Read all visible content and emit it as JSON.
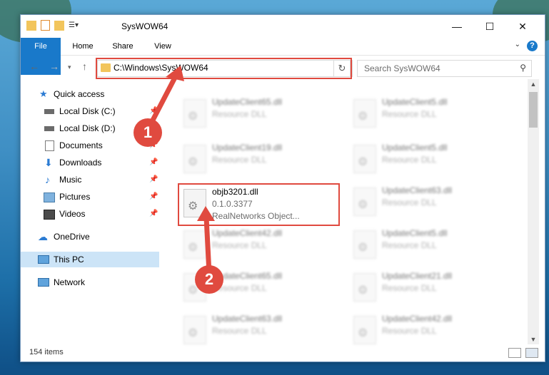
{
  "window": {
    "title": "SysWOW64",
    "controls": {
      "minimize": "—",
      "maximize": "☐",
      "close": "✕"
    }
  },
  "ribbon": {
    "tabs": [
      "File",
      "Home",
      "Share",
      "View"
    ],
    "help": "?"
  },
  "nav": {
    "address": "C:\\Windows\\SysWOW64",
    "search_placeholder": "Search SysWOW64"
  },
  "sidebar": {
    "items": [
      {
        "label": "Quick access",
        "icon": "star-icon",
        "pinned": false
      },
      {
        "label": "Local Disk (C:)",
        "icon": "drive-icon",
        "pinned": true
      },
      {
        "label": "Local Disk (D:)",
        "icon": "drive-icon",
        "pinned": false
      },
      {
        "label": "Documents",
        "icon": "document-icon",
        "pinned": true
      },
      {
        "label": "Downloads",
        "icon": "download-icon",
        "pinned": true
      },
      {
        "label": "Music",
        "icon": "music-icon",
        "pinned": true
      },
      {
        "label": "Pictures",
        "icon": "picture-icon",
        "pinned": true
      },
      {
        "label": "Videos",
        "icon": "video-icon",
        "pinned": true
      },
      {
        "label": "OneDrive",
        "icon": "cloud-icon",
        "pinned": false
      },
      {
        "label": "This PC",
        "icon": "computer-icon",
        "pinned": false
      },
      {
        "label": "Network",
        "icon": "network-icon",
        "pinned": false
      }
    ]
  },
  "files": {
    "highlighted": {
      "name": "objb3201.dll",
      "version": "0.1.0.3377",
      "company": "RealNetworks Object..."
    },
    "left": [
      {
        "name": "UpdateClient65.dll",
        "type": "Resource DLL"
      },
      {
        "name": "UpdateClient19.dll",
        "type": "Resource DLL"
      },
      {
        "name": "UpdateClient42.dll",
        "type": "Resource DLL"
      },
      {
        "name": "UpdateClient65.dll",
        "type": "Resource DLL"
      },
      {
        "name": "UpdateClient63.dll",
        "type": "Resource DLL"
      }
    ],
    "right": [
      {
        "name": "UpdateClient5.dll",
        "type": "Resource DLL"
      },
      {
        "name": "UpdateClient5.dll",
        "type": "Resource DLL"
      },
      {
        "name": "UpdateClient63.dll",
        "type": "Resource DLL"
      },
      {
        "name": "UpdateClient5.dll",
        "type": "Resource DLL"
      },
      {
        "name": "UpdateClient21.dll",
        "type": "Resource DLL"
      },
      {
        "name": "UpdateClient42.dll",
        "type": "Resource DLL"
      }
    ]
  },
  "status": {
    "item_count": "154 items"
  },
  "annotations": {
    "badge1": "1",
    "badge2": "2",
    "highlight_color": "#e04a3f"
  }
}
